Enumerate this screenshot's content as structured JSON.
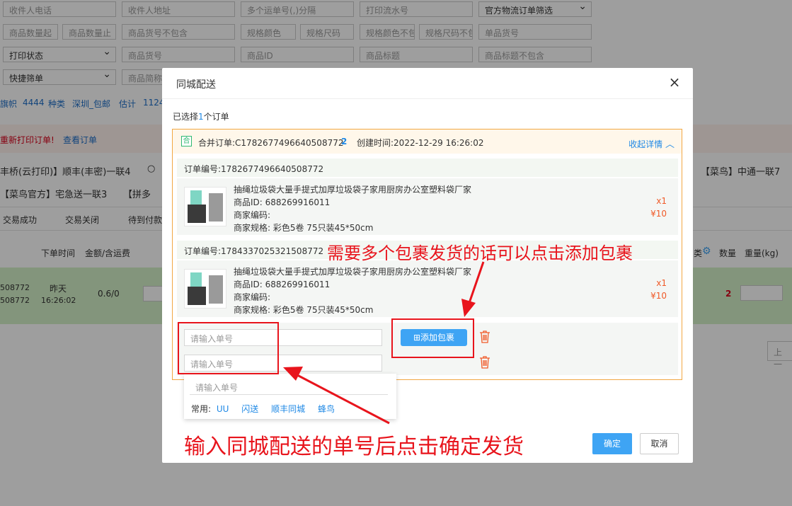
{
  "background": {
    "filters_row1": [
      "收件人电话",
      "收件人地址",
      "多个运单号(,)分隔",
      "打印流水号",
      "官方物流订单筛选"
    ],
    "filters_row2": [
      "商品数量起",
      "商品数量止",
      "商品货号不包含",
      "规格颜色",
      "规格尺码",
      "规格颜色不包",
      "规格尺码不包",
      "单品货号"
    ],
    "filters_row3": [
      "打印状态",
      "商品货号",
      "商品ID",
      "商品标题",
      "商品标题不包含"
    ],
    "filters_row4": [
      "快捷筛单",
      "商品简称"
    ],
    "tags": [
      "旗帜",
      "4444",
      "种类",
      "深圳_包邮",
      "估计",
      "1124"
    ],
    "notice": "重新打印订单!",
    "notice_link": "查看订单",
    "express_line1_left": "丰桥(云打印)】顺丰(丰密)一联4",
    "express_line1_right": "【菜鸟】中通一联7",
    "express_line2_left": "【菜鸟官方】宅急送一联3",
    "express_line2_right": "【拼多",
    "tabs": [
      "交易成功",
      "交易关闭",
      "待到付款"
    ],
    "col_time": "下单时间",
    "col_amount": "金额/含运费",
    "col_category": "类",
    "col_qty": "数量",
    "col_weight": "重量(kg)",
    "row_id1": "508772",
    "row_id2": "508772",
    "row_date": "昨天",
    "row_time": "16:26:02",
    "row_amount": "0.6/0",
    "row_qty": "2",
    "pager_prev": "上一"
  },
  "modal": {
    "title": "同城配送",
    "selected_prefix": "已选择",
    "selected_count": "1",
    "selected_suffix": "个订单",
    "merge_badge": "合",
    "merge_order": "合并订单:C1782677496640508772",
    "merge_count": "2",
    "created_time": "创建时间:2022-12-29 16:26:02",
    "collapse_label": "收起详情",
    "suborders": [
      {
        "order_no": "订单编号:1782677496640508772",
        "title": "抽绳垃圾袋大量手提式加厚垃圾袋子家用厨房办公室塑料袋厂家",
        "product_id": "商品ID:  688269916011",
        "merchant_code": "商家编码:",
        "spec": "商家规格:  彩色5卷 75只装45*50cm",
        "qty": "x1",
        "price": "¥10"
      },
      {
        "order_no": "订单编号:1784337025321508772",
        "title": "抽绳垃圾袋大量手提式加厚垃圾袋子家用厨房办公室塑料袋厂家",
        "product_id": "商品ID:  688269916011",
        "merchant_code": "商家编码:",
        "spec": "商家规格:  彩色5卷 75只装45*50cm",
        "qty": "x1",
        "price": "¥10"
      }
    ],
    "tracking_placeholder": "请输入单号",
    "add_package_label": "添加包裹",
    "dropdown_placeholder": "请输入单号",
    "dropdown_common_label": "常用:",
    "dropdown_options": [
      "UU",
      "闪送",
      "顺丰同城",
      "蜂鸟"
    ],
    "confirm_label": "确定",
    "cancel_label": "取消"
  },
  "annotations": {
    "top": "需要多个包裹发货的话可以点击添加包裹",
    "bottom": "输入同城配送的单号后点击确定发货",
    "color": "#e8141c"
  }
}
